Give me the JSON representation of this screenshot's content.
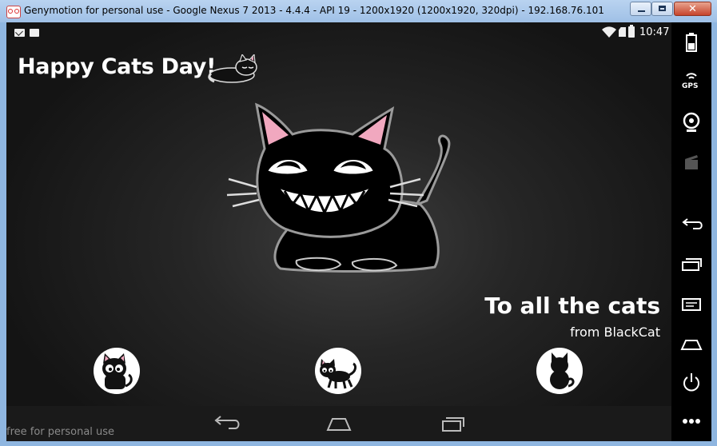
{
  "window": {
    "title": "Genymotion for personal use - Google Nexus 7 2013 - 4.4.4 - API 19 - 1200x1920 (1200x1920, 320dpi) - 192.168.76.101",
    "close_symbol": "✕"
  },
  "statusbar": {
    "time": "10:47",
    "icons": [
      "gmail-icon",
      "briefcase-icon",
      "wifi-icon",
      "sim-icon",
      "battery-icon"
    ]
  },
  "content": {
    "headline": "Happy Cats Day!",
    "tagline": "To all the cats",
    "from": "from BlackCat"
  },
  "apps": [
    {
      "name": "cat-sitting-app-icon"
    },
    {
      "name": "cat-walking-app-icon"
    },
    {
      "name": "cat-back-app-icon"
    }
  ],
  "navbar": [
    "back-icon",
    "home-icon",
    "recents-icon"
  ],
  "watermark": "free for personal use",
  "sidebar": {
    "gps_label": "GPS",
    "buttons": [
      "battery-icon",
      "gps-icon",
      "webcam-icon",
      "clapperboard-icon",
      "back-icon",
      "recents-icon",
      "menu-icon",
      "home-icon",
      "power-icon",
      "more-icon"
    ]
  },
  "colors": {
    "titlebar": "#9fc0e6",
    "screen_bg": "#262626",
    "close_button": "#c7442c",
    "cat_ear_pink": "#f1a8bf"
  }
}
